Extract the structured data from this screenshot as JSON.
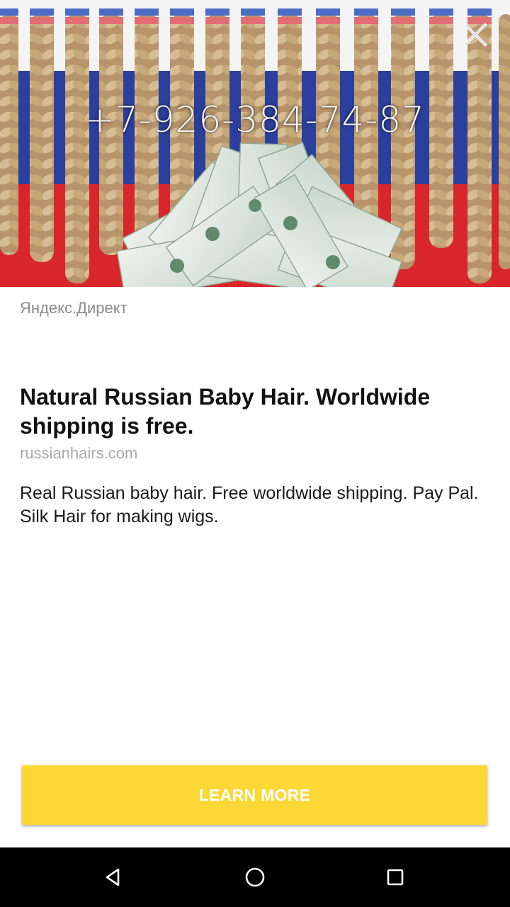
{
  "ad": {
    "image": {
      "phone_number": "+7-926-384-74-87"
    },
    "close_icon": "close-icon",
    "advertiser": "Яндекс.Директ",
    "headline": "Natural Russian Baby Hair. Worldwide shipping is free.",
    "domain": "russianhairs.com",
    "body": "Real Russian baby hair. Free worldwide shipping. Pay Pal. Silk Hair for making wigs.",
    "cta_label": "LEARN MORE"
  },
  "navbar": {
    "back_icon": "back-triangle-icon",
    "home_icon": "home-circle-icon",
    "recents_icon": "recents-square-icon"
  },
  "colors": {
    "cta_background": "#fcd837",
    "flag_white": "#f4f4f4",
    "flag_blue": "#2b3f9e",
    "flag_red": "#d8262b"
  }
}
